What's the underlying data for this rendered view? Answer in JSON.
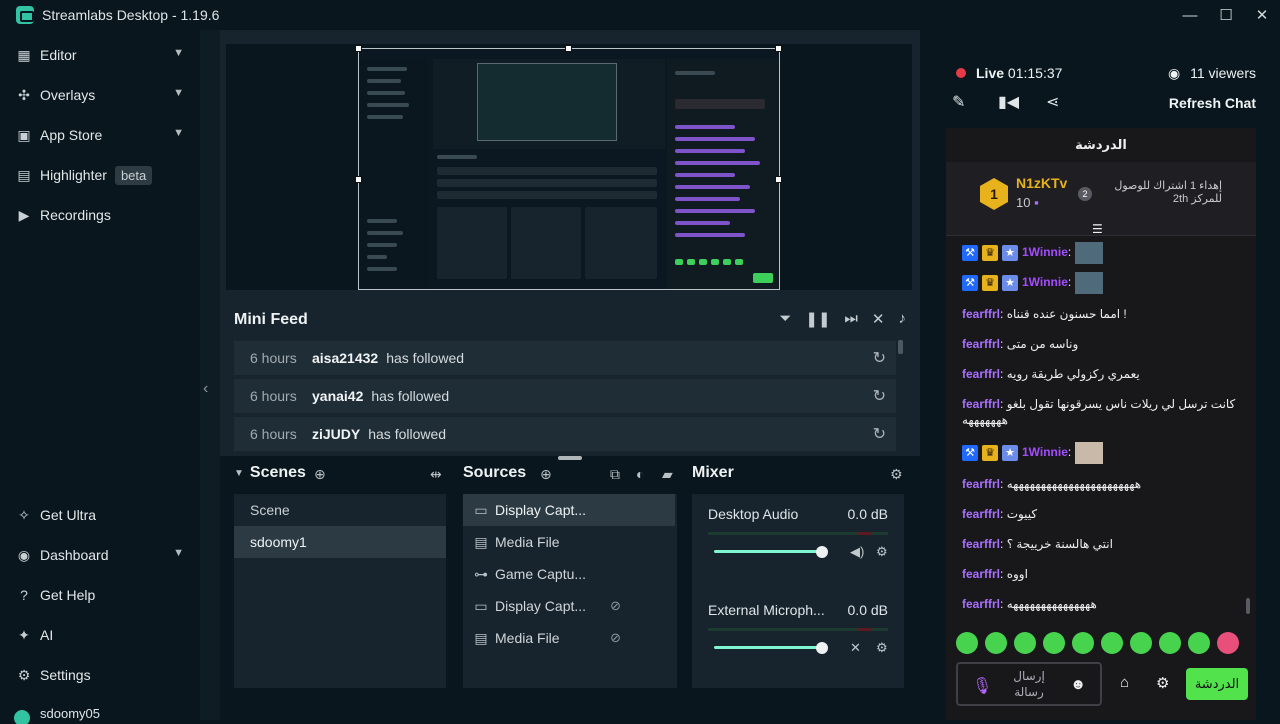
{
  "window": {
    "title": "Streamlabs Desktop - 1.19.6",
    "minimize": "—",
    "maximize": "☐",
    "close": "✕"
  },
  "sidebar": {
    "items": [
      {
        "label": "Editor",
        "icon": "editor-icon"
      },
      {
        "label": "Overlays",
        "icon": "overlays-icon"
      },
      {
        "label": "App Store",
        "icon": "app-store-icon"
      },
      {
        "label": "Highlighter",
        "icon": "highlighter-icon",
        "badge": "beta"
      },
      {
        "label": "Recordings",
        "icon": "recordings-icon"
      }
    ],
    "bottom_items": [
      {
        "label": "Get Ultra",
        "icon": "ultra-icon"
      },
      {
        "label": "Dashboard",
        "icon": "dashboard-icon"
      },
      {
        "label": "Get Help",
        "icon": "help-icon"
      },
      {
        "label": "AI",
        "icon": "ai-icon"
      },
      {
        "label": "Settings",
        "icon": "settings-icon"
      }
    ],
    "user": "sdoomy05"
  },
  "mini_feed": {
    "title": "Mini Feed",
    "events": [
      {
        "time": "6 hours",
        "user": "aisa21432",
        "action": "has followed"
      },
      {
        "time": "6 hours",
        "user": "yanai42",
        "action": "has followed"
      },
      {
        "time": "6 hours",
        "user": "ziJUDY",
        "action": "has followed"
      }
    ]
  },
  "scenes": {
    "title": "Scenes",
    "items": [
      "Scene",
      "sdoomy1"
    ],
    "active_index": 1
  },
  "sources": {
    "title": "Sources",
    "items": [
      {
        "label": "Display Capt...",
        "icon": "monitor-icon",
        "hidden": false
      },
      {
        "label": "Media File",
        "icon": "file-icon",
        "hidden": false
      },
      {
        "label": "Game Captu...",
        "icon": "gamepad-icon",
        "hidden": false
      },
      {
        "label": "Display Capt...",
        "icon": "monitor-icon",
        "hidden": true
      },
      {
        "label": "Media File",
        "icon": "file-icon",
        "hidden": true
      }
    ]
  },
  "mixer": {
    "title": "Mixer",
    "channels": [
      {
        "name": "Desktop Audio",
        "db": "0.0 dB",
        "volume": 0.9,
        "muted": false
      },
      {
        "name": "External Microph...",
        "db": "0.0 dB",
        "volume": 0.9,
        "muted": true
      }
    ]
  },
  "stream": {
    "live_label": "Live",
    "duration": "01:15:37",
    "viewers": "11 viewers",
    "refresh_label": "Refresh Chat"
  },
  "chat": {
    "header": "الدردشة",
    "pinned": {
      "rank": "1",
      "user": "N1zKTv",
      "points": "10",
      "gift_rank": "2",
      "gift_text": "إهداء 1 اشتراك للوصول للمركز 2th"
    },
    "messages": [
      {
        "user": "1Winnie",
        "text": "",
        "badges": true,
        "avatar": true
      },
      {
        "user": "1Winnie",
        "text": "",
        "badges": true,
        "avatar": true
      },
      {
        "user": "fearffrl",
        "text": "امما حسنون عنده قنناه !",
        "badges": false
      },
      {
        "user": "fearffrl",
        "text": "وناسه من متى",
        "badges": false
      },
      {
        "user": "fearffrl",
        "text": "يعمري ركزولي طريقة رويه",
        "badges": false
      },
      {
        "user": "fearffrl",
        "text": "كانت ترسل لي ريلات ناس يسرقونها تقول بلغو هههههههه",
        "badges": false
      },
      {
        "user": "1Winnie",
        "text": "",
        "badges": true,
        "avatar": true
      },
      {
        "user": "fearffrl",
        "text": "هههههههههههههههههههههههه",
        "badges": false
      },
      {
        "user": "fearffrl",
        "text": "كييوت",
        "badges": false
      },
      {
        "user": "fearffrl",
        "text": "انتي هالسنة خرييجة ؟",
        "badges": false
      },
      {
        "user": "fearffrl",
        "text": "اووه",
        "badges": false
      },
      {
        "user": "fearffrl",
        "text": "هههههههههههههههه",
        "badges": false
      }
    ],
    "input_placeholder": "إرسال رسالة",
    "send_label": "الدردشة"
  },
  "colors": {
    "accent": "#31c3a2",
    "live": "#e63a47",
    "chat_send": "#52e24c",
    "username_purple": "#a970ff",
    "gold": "#e8b21c"
  }
}
